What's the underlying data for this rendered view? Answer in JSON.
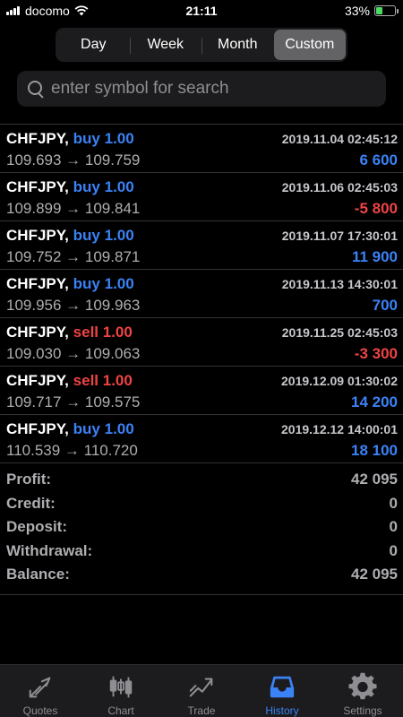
{
  "status_bar": {
    "carrier": "docomo",
    "time": "21:11",
    "battery": "33%",
    "battery_level": 0.33
  },
  "period_tabs": [
    {
      "label": "Day",
      "active": false
    },
    {
      "label": "Week",
      "active": false
    },
    {
      "label": "Month",
      "active": false
    },
    {
      "label": "Custom",
      "active": true
    }
  ],
  "search": {
    "placeholder": "enter symbol for search",
    "value": ""
  },
  "deals": [
    {
      "symbol": "CHFJPY,",
      "type": "buy",
      "volume": "1.00",
      "time": "2019.11.04 02:45:12",
      "prices": "109.693 → 109.759",
      "profit": "6 600",
      "positive": true
    },
    {
      "symbol": "CHFJPY,",
      "type": "buy",
      "volume": "1.00",
      "time": "2019.11.06 02:45:03",
      "prices": "109.899 → 109.841",
      "profit": "-5 800",
      "positive": false
    },
    {
      "symbol": "CHFJPY,",
      "type": "buy",
      "volume": "1.00",
      "time": "2019.11.07 17:30:01",
      "prices": "109.752 → 109.871",
      "profit": "11 900",
      "positive": true
    },
    {
      "symbol": "CHFJPY,",
      "type": "buy",
      "volume": "1.00",
      "time": "2019.11.13 14:30:01",
      "prices": "109.956 → 109.963",
      "profit": "700",
      "positive": true
    },
    {
      "symbol": "CHFJPY,",
      "type": "sell",
      "volume": "1.00",
      "time": "2019.11.25 02:45:03",
      "prices": "109.030 → 109.063",
      "profit": "-3 300",
      "positive": false
    },
    {
      "symbol": "CHFJPY,",
      "type": "sell",
      "volume": "1.00",
      "time": "2019.12.09 01:30:02",
      "prices": "109.717 → 109.575",
      "profit": "14 200",
      "positive": true
    },
    {
      "symbol": "CHFJPY,",
      "type": "buy",
      "volume": "1.00",
      "time": "2019.12.12 14:00:01",
      "prices": "110.539 → 110.720",
      "profit": "18 100",
      "positive": true
    }
  ],
  "summary": [
    {
      "label": "Profit:",
      "value": "42 095"
    },
    {
      "label": "Credit:",
      "value": "0"
    },
    {
      "label": "Deposit:",
      "value": "0"
    },
    {
      "label": "Withdrawal:",
      "value": "0"
    },
    {
      "label": "Balance:",
      "value": "42 095"
    }
  ],
  "tabbar": [
    {
      "label": "Quotes",
      "icon": "quotes-icon",
      "active": false
    },
    {
      "label": "Chart",
      "icon": "chart-icon",
      "active": false
    },
    {
      "label": "Trade",
      "icon": "trade-icon",
      "active": false
    },
    {
      "label": "History",
      "icon": "history-icon",
      "active": true
    },
    {
      "label": "Settings",
      "icon": "gear-icon",
      "active": false
    }
  ],
  "colors": {
    "accent": "#3b82f6",
    "loss": "#ef4444",
    "battery": "#4cd964"
  }
}
